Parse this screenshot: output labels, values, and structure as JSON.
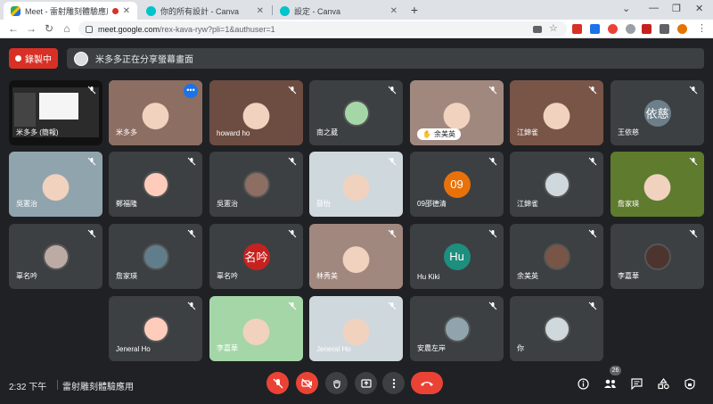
{
  "browser": {
    "tabs": [
      {
        "title": "Meet - 雷射雕刻體驗應用",
        "active": true
      },
      {
        "title": "你的所有設計 - Canva",
        "active": false
      },
      {
        "title": "設定 - Canva",
        "active": false
      }
    ],
    "url_host": "meet.google.com",
    "url_path": "/rex-kava-ryw?pli=1&authuser=1"
  },
  "meet": {
    "recording_label": "錄製中",
    "presenting_text": "米多多正在分享螢幕畫面",
    "meeting_time": "2:32 下午",
    "meeting_name": "雷射雕刻體驗應用",
    "participant_count": "26",
    "accent_red": "#ea4335",
    "tiles": [
      {
        "name": "米多多 (簡報)",
        "type": "screen"
      },
      {
        "name": "米多多",
        "type": "video"
      },
      {
        "name": "howard ho",
        "type": "video"
      },
      {
        "name": "南之葳",
        "type": "avatar"
      },
      {
        "name": "余美英",
        "type": "video"
      },
      {
        "name": "江錦雀",
        "type": "video"
      },
      {
        "name": "王依慈",
        "type": "letter",
        "letter": "依慈"
      },
      {
        "name": "吳憲治",
        "type": "video"
      },
      {
        "name": "鄭福隆",
        "type": "avatar"
      },
      {
        "name": "吳憲治",
        "type": "avatar"
      },
      {
        "name": "薛怡",
        "type": "video"
      },
      {
        "name": "09邵德清",
        "type": "letter",
        "letter": "09"
      },
      {
        "name": "江錦雀",
        "type": "avatar"
      },
      {
        "name": "詹家瑛",
        "type": "video"
      },
      {
        "name": "辜名吟",
        "type": "avatar"
      },
      {
        "name": "詹家瑛",
        "type": "avatar"
      },
      {
        "name": "辜名吟",
        "type": "letter",
        "letter": "名吟"
      },
      {
        "name": "林秀美",
        "type": "video"
      },
      {
        "name": "Hu Kiki",
        "type": "letter",
        "letter": "Hu"
      },
      {
        "name": "余美英",
        "type": "avatar"
      },
      {
        "name": "李嘉華",
        "type": "avatar"
      },
      {
        "name": "Jeneral Ho",
        "type": "avatar"
      },
      {
        "name": "李嘉華",
        "type": "video"
      },
      {
        "name": "Jeneral Ho",
        "type": "video"
      },
      {
        "name": "安農左岸",
        "type": "avatar"
      },
      {
        "name": "你",
        "type": "avatar"
      }
    ]
  }
}
